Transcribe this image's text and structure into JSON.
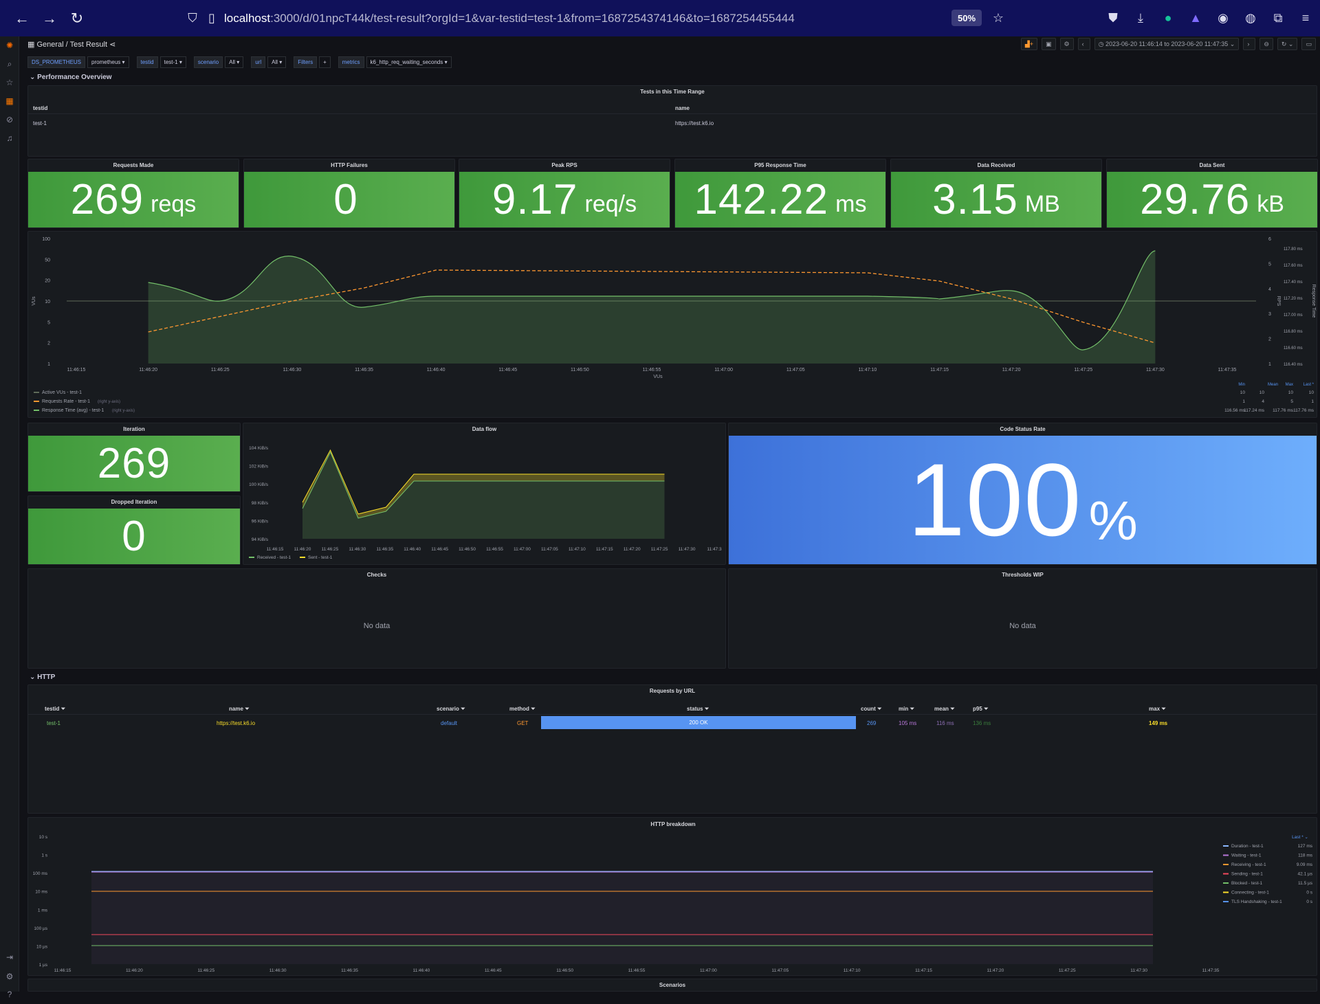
{
  "browser": {
    "url_host": "localhost",
    "url_path": ":3000/d/01npcT44k/test-result?orgId=1&var-testid=test-1&from=1687254374146&to=1687254455444",
    "zoom": "50%"
  },
  "topbar": {
    "breadcrumb_root": "General",
    "breadcrumb_sep": "/",
    "breadcrumb_page": "Test Result",
    "time_range": "2023-06-20 11:46:14 to 2023-06-20 11:47:35"
  },
  "variables": [
    {
      "label": "DS_PROMETHEUS",
      "value": "prometheus ▾"
    },
    {
      "label": "testid",
      "value": "test-1 ▾"
    },
    {
      "label": "scenario",
      "value": "All ▾"
    },
    {
      "label": "url",
      "value": "All ▾"
    },
    {
      "label": "Filters",
      "value": "+"
    },
    {
      "label": "metrics",
      "value": "k6_http_req_waiting_seconds ▾"
    }
  ],
  "rows": {
    "performance": "Performance Overview",
    "http": "HTTP"
  },
  "tests_table": {
    "title": "Tests in this Time Range",
    "headers": [
      "testid",
      "name"
    ],
    "rows": [
      [
        "test-1",
        "https://test.k6.io"
      ]
    ]
  },
  "stats": [
    {
      "title": "Requests Made",
      "value": "269",
      "unit": "reqs"
    },
    {
      "title": "HTTP Failures",
      "value": "0",
      "unit": ""
    },
    {
      "title": "Peak RPS",
      "value": "9.17",
      "unit": "req/s"
    },
    {
      "title": "P95 Response Time",
      "value": "142.22",
      "unit": "ms"
    },
    {
      "title": "Data Received",
      "value": "3.15",
      "unit": "MB"
    },
    {
      "title": "Data Sent",
      "value": "29.76",
      "unit": "kB"
    }
  ],
  "main_chart": {
    "left_ticks": [
      "100",
      "50",
      "20",
      "10",
      "5",
      "2",
      "1"
    ],
    "right_ticks_rps": [
      "6",
      "5",
      "4",
      "3",
      "2",
      "1"
    ],
    "right_ticks_ms": [
      "117.80 ms",
      "117.60 ms",
      "117.40 ms",
      "117.20 ms",
      "117.00 ms",
      "116.80 ms",
      "116.60 ms",
      "116.40 ms"
    ],
    "x_ticks": [
      "11:46:15",
      "11:46:20",
      "11:46:25",
      "11:46:30",
      "11:46:35",
      "11:46:40",
      "11:46:45",
      "11:46:50",
      "11:46:55",
      "11:47:00",
      "11:47:05",
      "11:47:10",
      "11:47:15",
      "11:47:20",
      "11:47:25",
      "11:47:30",
      "11:47:35"
    ],
    "y_left_label": "VUs",
    "x_label": "VUs",
    "y_right_label_1": "RPS",
    "y_right_label_2": "Response Time",
    "legend_headers": [
      "Min",
      "Mean",
      "Max",
      "Last *"
    ],
    "legend": [
      {
        "name": "Active VUs - test-1",
        "suffix": "",
        "color": "#5f6b5a",
        "stats": [
          "10",
          "10",
          "10",
          "10"
        ]
      },
      {
        "name": "Requests Rate - test-1",
        "suffix": "(right y-axis)",
        "color": "#ff9830",
        "stats": [
          "1",
          "4",
          "5",
          "1"
        ]
      },
      {
        "name": "Response Time (avg) - test-1",
        "suffix": "(right y-axis)",
        "color": "#73bf69",
        "stats": [
          "116.56 ms",
          "117.24 ms",
          "117.76 ms",
          "117.76 ms"
        ]
      }
    ]
  },
  "iteration": {
    "title": "Iteration",
    "value": "269"
  },
  "dropped": {
    "title": "Dropped Iteration",
    "value": "0"
  },
  "dataflow": {
    "title": "Data flow",
    "y_ticks": [
      "104 KiB/s",
      "102 KiB/s",
      "100 KiB/s",
      "98 KiB/s",
      "96 KiB/s",
      "94 KiB/s"
    ],
    "x_ticks": [
      "11:46:15",
      "11:46:20",
      "11:46:25",
      "11:46:30",
      "11:46:35",
      "11:46:40",
      "11:46:45",
      "11:46:50",
      "11:46:55",
      "11:47:00",
      "11:47:05",
      "11:47:10",
      "11:47:15",
      "11:47:20",
      "11:47:25",
      "11:47:30",
      "11:47:3"
    ],
    "legend": [
      {
        "name": "Received - test-1",
        "color": "#73bf69"
      },
      {
        "name": "Sent - test-1",
        "color": "#fade2a"
      }
    ]
  },
  "code_status": {
    "title": "Code Status Rate",
    "value": "100",
    "unit": "%"
  },
  "checks": {
    "title": "Checks",
    "nodata": "No data"
  },
  "thresholds": {
    "title": "Thresholds WIP",
    "nodata": "No data"
  },
  "requests_by_url": {
    "title": "Requests by URL",
    "headers": [
      "testid",
      "name",
      "scenario",
      "method",
      "status",
      "count",
      "min",
      "mean",
      "p95",
      "max"
    ],
    "row": {
      "testid": "test-1",
      "name": "https://test.k6.io",
      "scenario": "default",
      "method": "GET",
      "status": "200 OK",
      "count": "269",
      "min": "105 ms",
      "mean": "116 ms",
      "p95": "136 ms",
      "max": "149 ms"
    }
  },
  "breakdown": {
    "title": "HTTP breakdown",
    "y_ticks": [
      "10 s",
      "1 s",
      "100 ms",
      "10 ms",
      "1 ms",
      "100 µs",
      "10 µs",
      "1 µs"
    ],
    "x_ticks": [
      "11:46:15",
      "11:46:20",
      "11:46:25",
      "11:46:30",
      "11:46:35",
      "11:46:40",
      "11:46:45",
      "11:46:50",
      "11:46:55",
      "11:47:00",
      "11:47:05",
      "11:47:10",
      "11:47:15",
      "11:47:20",
      "11:47:25",
      "11:47:30",
      "11:47:35"
    ],
    "legend_header": "Last * ⌄",
    "legend": [
      {
        "name": "Duration - test-1",
        "value": "127 ms",
        "color": "#8ab8ff"
      },
      {
        "name": "Waiting - test-1",
        "value": "118 ms",
        "color": "#b877d9"
      },
      {
        "name": "Receiving - test-1",
        "value": "9.09 ms",
        "color": "#ff9830"
      },
      {
        "name": "Sending - test-1",
        "value": "42.1 µs",
        "color": "#f2495c"
      },
      {
        "name": "Blocked - test-1",
        "value": "11.5 µs",
        "color": "#73bf69"
      },
      {
        "name": "Connecting - test-1",
        "value": "0 s",
        "color": "#fade2a"
      },
      {
        "name": "TLS Handshaking - test-1",
        "value": "0 s",
        "color": "#5794f2"
      }
    ]
  },
  "scenarios": {
    "title": "Scenarios"
  }
}
